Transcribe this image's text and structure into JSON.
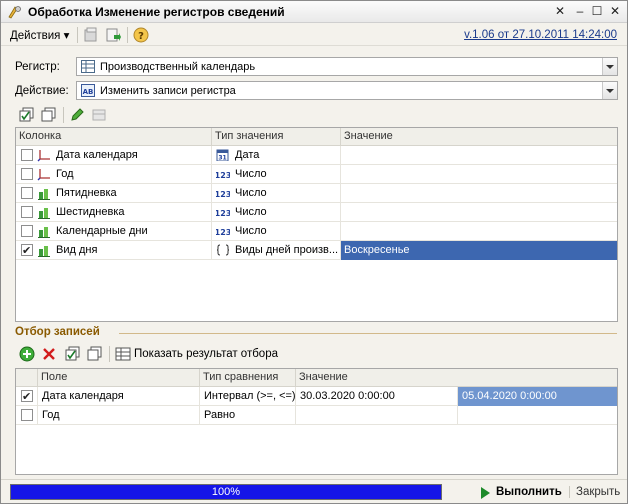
{
  "window": {
    "title": "Обработка  Изменение регистров сведений",
    "icon": "processing-gear-icon"
  },
  "toolbar": {
    "actions_label": "Действия",
    "version_link": "v.1.06 от 27.10.2011 14:24:00"
  },
  "form": {
    "register_label": "Регистр:",
    "register_value": "Производственный календарь",
    "action_label": "Действие:",
    "action_value": "Изменить записи регистра"
  },
  "columns_table": {
    "headers": [
      "Колонка",
      "Тип значения",
      "Значение"
    ],
    "rows": [
      {
        "checked": false,
        "kind": "dimension",
        "name": "Дата календаря",
        "type_icon": "date-type-icon",
        "type": "Дата",
        "value": "",
        "selected": false
      },
      {
        "checked": false,
        "kind": "dimension",
        "name": "Год",
        "type_icon": "number-type-icon",
        "type": "Число",
        "value": "",
        "selected": false
      },
      {
        "checked": false,
        "kind": "resource",
        "name": "Пятидневка",
        "type_icon": "number-type-icon",
        "type": "Число",
        "value": "",
        "selected": false
      },
      {
        "checked": false,
        "kind": "resource",
        "name": "Шестидневка",
        "type_icon": "number-type-icon",
        "type": "Число",
        "value": "",
        "selected": false
      },
      {
        "checked": false,
        "kind": "resource",
        "name": "Календарные дни",
        "type_icon": "number-type-icon",
        "type": "Число",
        "value": "",
        "selected": false
      },
      {
        "checked": true,
        "kind": "resource",
        "name": "Вид дня",
        "type_icon": "enum-type-icon",
        "type": "Виды дней произв...",
        "value": "Воскресенье",
        "selected": true
      }
    ]
  },
  "filter": {
    "section_title": "Отбор записей",
    "show_result_label": "Показать результат отбора",
    "headers": [
      "Поле",
      "Тип сравнения",
      "Значение"
    ],
    "rows": [
      {
        "checked": true,
        "field": "Дата календаря",
        "comparison": "Интервал (>=, <=)",
        "value_from": "30.03.2020 0:00:00",
        "value_to": "05.04.2020 0:00:00"
      },
      {
        "checked": false,
        "field": "Год",
        "comparison": "Равно",
        "value_from": "",
        "value_to": ""
      }
    ]
  },
  "status": {
    "progress": 100,
    "progress_text": "100%",
    "run_label": "Выполнить",
    "close_label": "Закрыть"
  },
  "colors": {
    "selection": "#3d67b0",
    "progress": "#1515e8",
    "section_title": "#8a5a00",
    "run_icon": "#1d8a2a"
  }
}
